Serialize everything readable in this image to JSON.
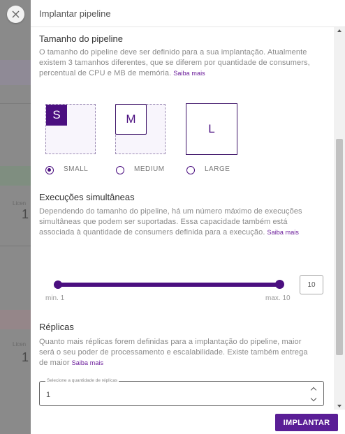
{
  "background": {
    "left_labels": [
      "Licen",
      "Licen"
    ],
    "left_numbers": [
      "1",
      "1"
    ]
  },
  "drawer": {
    "title": "Implantar pipeline",
    "close_icon": "close-icon"
  },
  "pipeline_size": {
    "title": "Tamanho do pipeline",
    "description": "O tamanho do pipeline deve ser definido para a sua implantação. Atualmente existem 3 tamanhos diferentes, que se diferem por quantidade de consumers, percentual de CPU e MB de memória.",
    "link": "Saiba mais",
    "cards": [
      {
        "badge": "S",
        "selected": true
      },
      {
        "badge": "M",
        "selected": false
      },
      {
        "badge": "L",
        "selected": false
      }
    ],
    "options": [
      {
        "label": "SMALL",
        "checked": true
      },
      {
        "label": "MEDIUM",
        "checked": false
      },
      {
        "label": "LARGE",
        "checked": false
      }
    ]
  },
  "concurrent": {
    "title": "Execuções simultâneas",
    "description": "Dependendo do tamanho do pipeline, há um número máximo de execuções simultâneas que podem ser suportadas. Essa capacidade também está associada à quantidade de consumers definida para a execução.",
    "link": "Saiba mais",
    "slider": {
      "min_label": "min. 1",
      "max_label": "max. 10",
      "min": 1,
      "max": 10,
      "value": 10,
      "value_text": "10"
    }
  },
  "replicas": {
    "title": "Réplicas",
    "description": "Quanto mais réplicas forem definidas para a implantação do pipeline, maior será o seu poder de processamento e escalabilidade. Existe também entrega de maior",
    "link": "Saiba mais",
    "select": {
      "legend": "Selecione a quantidade de réplicas",
      "value": "1"
    }
  },
  "footer": {
    "submit_label": "IMPLANTAR"
  },
  "colors": {
    "accent": "#4b0f80",
    "button": "#5a1e96",
    "overlay": "#8a8a8a"
  }
}
